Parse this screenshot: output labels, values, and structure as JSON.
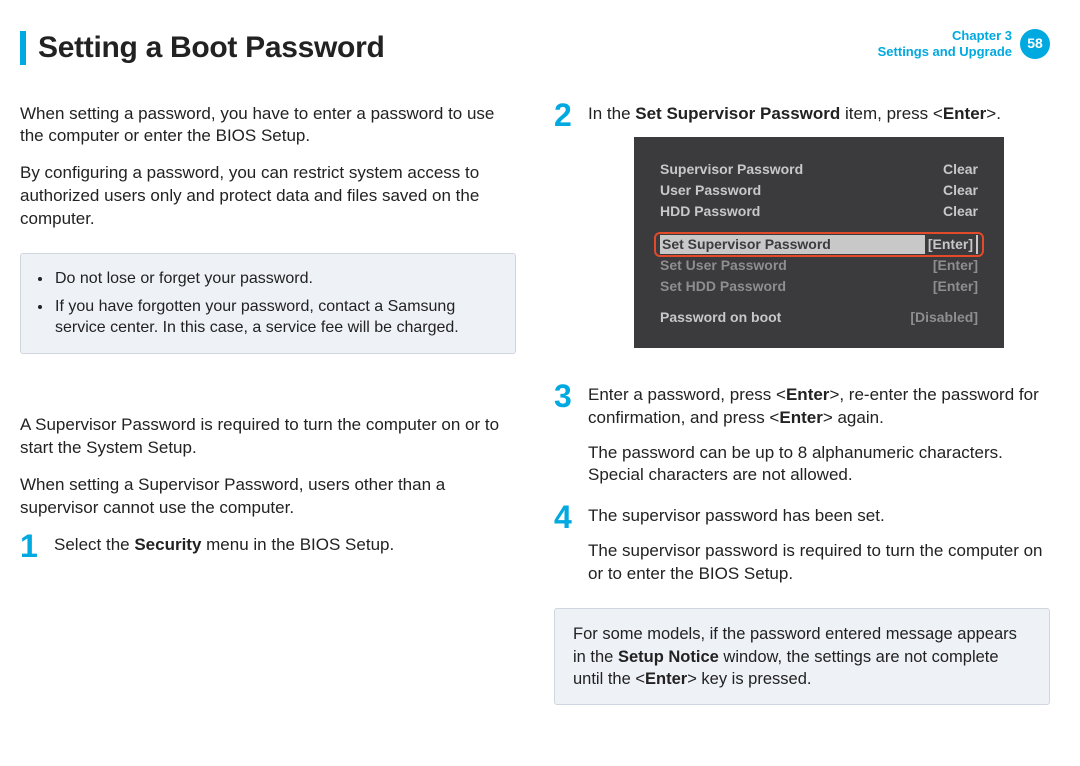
{
  "header": {
    "title": "Setting a Boot Password",
    "chapter_line1": "Chapter 3",
    "chapter_line2": "Settings and Upgrade",
    "page_number": "58"
  },
  "left": {
    "p1": "When setting a password, you have to enter a password to use the computer or enter the BIOS Setup.",
    "p2": "By configuring a password, you can restrict system access to authorized users only and protect data and files saved on the computer.",
    "caution": [
      "Do not lose or forget your password.",
      "If you have forgotten your password, contact a Samsung service center. In this case, a service fee will be charged."
    ],
    "p3": "A Supervisor Password is required to turn the computer on or to start the System Setup.",
    "p4": "When setting a Supervisor Password, users other than a supervisor cannot use the computer.",
    "step1_pre": "Select the ",
    "step1_bold": "Security",
    "step1_post": " menu in the BIOS Setup."
  },
  "right": {
    "step2_pre": "In the ",
    "step2_bold": "Set Supervisor Password",
    "step2_post": " item, press <",
    "step2_enter": "Enter",
    "step2_close": ">.",
    "step3_line1_a": "Enter a password, press <",
    "step3_line1_b": ">, re-enter the password for confirmation, and press <",
    "step3_line1_c": "> again.",
    "step3_enter": "Enter",
    "step3_line2": "The password can be up to 8 alphanumeric characters. Special characters are not allowed.",
    "step4_line1": "The supervisor password has been set.",
    "step4_line2": "The supervisor password is required to turn the computer on or to enter the BIOS Setup.",
    "notice_pre": "For some models, if the password entered message appears in the ",
    "notice_bold": "Setup Notice",
    "notice_mid": " window, the settings are not complete until the <",
    "notice_enter": "Enter",
    "notice_post": "> key is pressed."
  },
  "bios": {
    "rows1": [
      {
        "label": "Supervisor Password",
        "value": "Clear"
      },
      {
        "label": "User Password",
        "value": "Clear"
      },
      {
        "label": "HDD Password",
        "value": "Clear"
      }
    ],
    "highlight": {
      "label": "Set Supervisor Password",
      "value": "[Enter]"
    },
    "rows2": [
      {
        "label": "Set User Password",
        "value": "[Enter]"
      },
      {
        "label": "Set HDD Password",
        "value": "[Enter]"
      }
    ],
    "rows3": [
      {
        "label": "Password on boot",
        "value": "[Disabled]"
      }
    ]
  }
}
